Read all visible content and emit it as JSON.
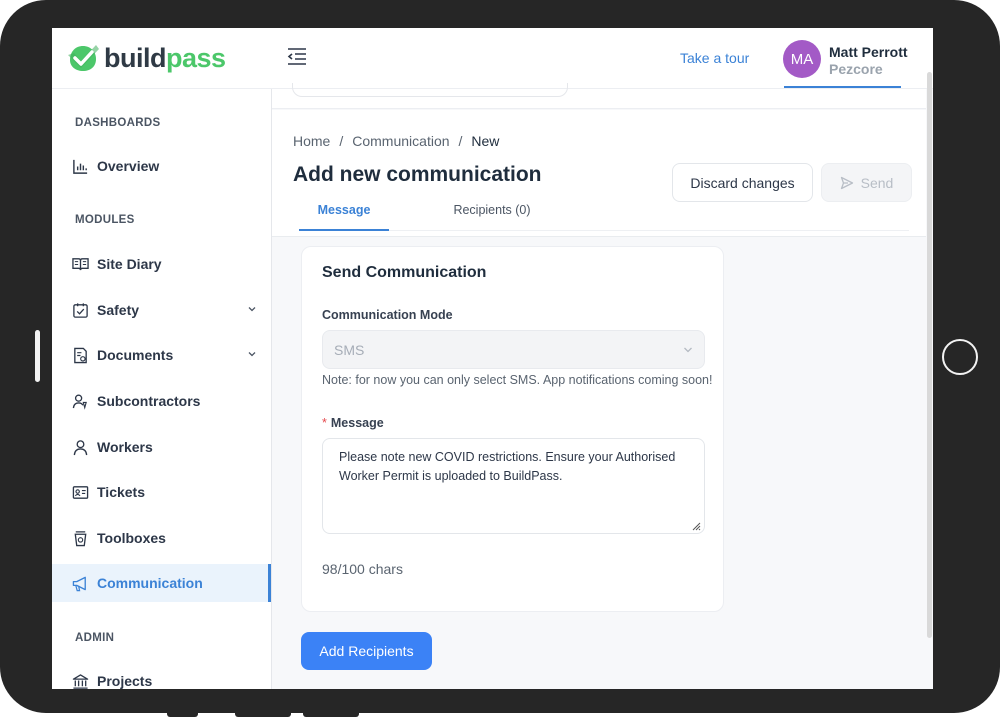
{
  "header": {
    "logo_part1": "build",
    "logo_part2": "pass",
    "tour_link": "Take a tour",
    "user": {
      "initials": "MA",
      "name": "Matt Perrott",
      "org": "Pezcore",
      "avatar_color": "#a35ac6"
    }
  },
  "sidebar": {
    "sections": {
      "dashboards": "DASHBOARDS",
      "modules": "MODULES",
      "admin": "ADMIN"
    },
    "items": [
      {
        "label": "Overview",
        "icon": "bar-chart-icon"
      },
      {
        "label": "Site Diary",
        "icon": "book-icon"
      },
      {
        "label": "Safety",
        "icon": "checkbox-icon",
        "expandable": true
      },
      {
        "label": "Documents",
        "icon": "document-icon",
        "expandable": true
      },
      {
        "label": "Subcontractors",
        "icon": "users-icon"
      },
      {
        "label": "Workers",
        "icon": "user-icon"
      },
      {
        "label": "Tickets",
        "icon": "id-card-icon"
      },
      {
        "label": "Toolboxes",
        "icon": "cup-icon"
      },
      {
        "label": "Communication",
        "icon": "megaphone-icon",
        "active": true
      },
      {
        "label": "Projects",
        "icon": "bank-icon"
      }
    ]
  },
  "breadcrumb": {
    "home": "Home",
    "section": "Communication",
    "current": "New",
    "separator": "/"
  },
  "page": {
    "title": "Add new communication",
    "discard_label": "Discard changes",
    "send_label": "Send"
  },
  "tabs": {
    "message": "Message",
    "recipients": "Recipients (0)"
  },
  "form": {
    "card_title": "Send Communication",
    "mode_label": "Communication Mode",
    "mode_value": "SMS",
    "mode_note": "Note: for now you can only select SMS. App notifications coming soon!",
    "required_mark": "*",
    "message_label": "Message",
    "message_value": "Please note new COVID restrictions. Ensure your Authorised Worker Permit is uploaded to BuildPass.",
    "char_count": "98/100 chars"
  },
  "actions": {
    "add_recipients": "Add Recipients"
  },
  "colors": {
    "accent": "#3b82d6",
    "brand_green": "#4cc76a",
    "primary_button": "#3b82f6"
  }
}
